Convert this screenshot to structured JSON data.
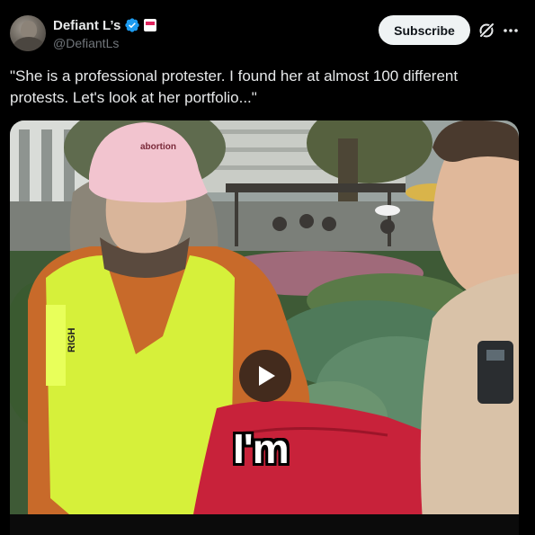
{
  "author": {
    "display_name": "Defiant L’s",
    "handle": "@DefiantLs"
  },
  "actions": {
    "subscribe_label": "Subscribe"
  },
  "post": {
    "text": "\"She is a professional protester. I found her at almost 100 different protests. Let's look at her portfolio...\""
  },
  "media": {
    "caption": "I'm",
    "cap_text": "abortion",
    "vest_text": "RIGH"
  },
  "icons": {
    "verified": "verified-badge-icon",
    "affiliate": "brand-affiliate-icon",
    "grok": "grok-icon",
    "more": "more-icon",
    "play": "play-icon"
  },
  "colors": {
    "background": "#000000",
    "text": "#e7e9ea",
    "secondary_text": "#71767b",
    "verified_blue": "#1d9bf0",
    "subscribe_bg": "#eff3f4"
  }
}
